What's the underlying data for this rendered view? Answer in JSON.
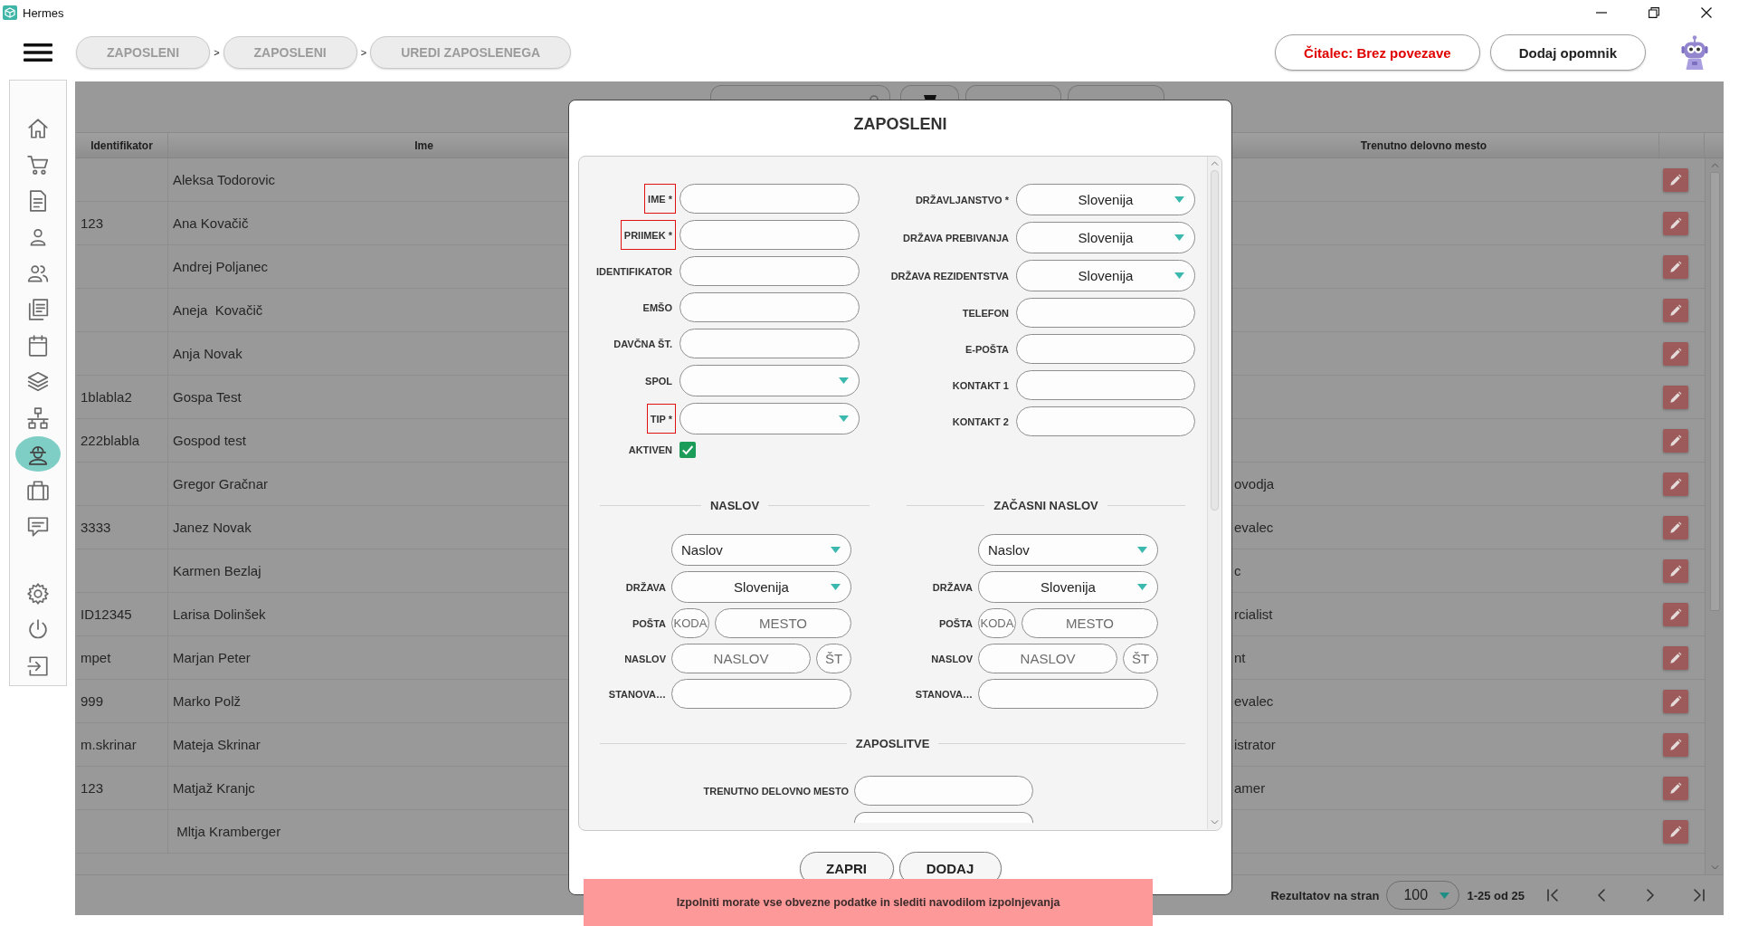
{
  "window": {
    "title": "Hermes"
  },
  "top_bar": {
    "breadcrumbs": [
      {
        "label": "ZAPOSLENI"
      },
      {
        "separator": ">",
        "label": "ZAPOSLENI"
      },
      {
        "separator": ">",
        "label": "UREDI ZAPOSLENEGA"
      }
    ],
    "buttons": [
      {
        "label": "Čitalec: Brez povezave",
        "kind": "alert"
      },
      {
        "label": "Dodaj opomnik",
        "kind": "plain"
      }
    ]
  },
  "sidebar": {
    "items": [
      {
        "selected": false
      },
      {
        "selected": false
      },
      {
        "selected": false
      },
      {
        "selected": false
      },
      {
        "selected": false
      },
      {
        "selected": false
      },
      {
        "selected": false
      },
      {
        "selected": false
      },
      {
        "selected": false
      },
      {
        "selected": true
      },
      {
        "selected": false
      },
      {
        "selected": false
      }
    ],
    "bottom_items": [
      {
        "selected": false
      },
      {
        "selected": false
      },
      {
        "selected": false
      }
    ]
  },
  "table": {
    "columns": [
      {
        "label": "Identifikator"
      },
      {
        "label": "Ime"
      },
      {
        "label": "Trenutno delovno mesto"
      }
    ],
    "rows": [
      {
        "ime": "Aleksa Todorovic"
      },
      {
        "identifikator": "123",
        "ime": "Ana Kovačič"
      },
      {
        "ime": "Andrej Poljanec"
      },
      {
        "ime": "Aneja  Kovačič"
      },
      {
        "ime": "Anja Novak"
      },
      {
        "identifikator": "1blabla2",
        "ime": "Gospa Test"
      },
      {
        "identifikator": "222blabla",
        "ime": "Gospod test"
      },
      {
        "ime": "Gregor Gračnar",
        "trenutno_delovno_mesto": "ovodja"
      },
      {
        "identifikator": "3333",
        "ime": "Janez Novak",
        "trenutno_delovno_mesto": "evalec"
      },
      {
        "ime": "Karmen Bezlaj",
        "trenutno_delovno_mesto": "c"
      },
      {
        "identifikator": "ID12345",
        "ime": "Larisa Dolinšek",
        "trenutno_delovno_mesto": "rcialist"
      },
      {
        "identifikator": "mpet",
        "ime": "Marjan Peter",
        "trenutno_delovno_mesto": "nt"
      },
      {
        "identifikator": "999",
        "ime": "Marko Polž",
        "trenutno_delovno_mesto": "evalec"
      },
      {
        "identifikator": "m.skrinar",
        "ime": "Mateja Skrinar",
        "trenutno_delovno_mesto": "istrator"
      },
      {
        "identifikator": "123",
        "ime": "Matjaž Kranjc",
        "trenutno_delovno_mesto": "amer"
      },
      {
        "ime": " Mltja Kramberger"
      }
    ]
  },
  "pagination": {
    "label": "Rezultatov na stran",
    "page_size": "100",
    "range": "1-25 od 25"
  },
  "modal": {
    "title": "ZAPOSLENI",
    "left_fields": [
      {
        "label": "IME *",
        "kind": "text",
        "error": true
      },
      {
        "label": "PRIIMEK *",
        "kind": "text",
        "error": true
      },
      {
        "label": "IDENTIFIKATOR",
        "kind": "text",
        "error": false
      },
      {
        "label": "EMŠO",
        "kind": "text",
        "error": false
      },
      {
        "label": "DAVČNA ŠT.",
        "kind": "text",
        "error": false
      },
      {
        "label": "SPOL",
        "kind": "select",
        "error": false
      },
      {
        "label": "TIP *",
        "kind": "select",
        "error": true
      }
    ],
    "active": {
      "label": "AKTIVEN",
      "checked": true
    },
    "right_fields": [
      {
        "label": "DRŽAVLJANSTVO *",
        "kind": "select",
        "value": "Slovenija",
        "error": false
      },
      {
        "label": "DRŽAVA PREBIVANJA",
        "kind": "select",
        "value": "Slovenija",
        "error": false
      },
      {
        "label": "DRŽAVA REZIDENTSTVA",
        "kind": "select",
        "value": "Slovenija",
        "error": false
      },
      {
        "label": "TELEFON",
        "kind": "text",
        "error": false
      },
      {
        "label": "E-POŠTA",
        "kind": "text",
        "error": false
      },
      {
        "label": "KONTAKT 1",
        "kind": "text",
        "error": false
      },
      {
        "label": "KONTAKT 2",
        "kind": "text",
        "error": false
      }
    ],
    "addresses": [
      {
        "title": "NASLOV",
        "type": "Naslov",
        "country_label": "DRŽAVA",
        "country": "Slovenija",
        "post_label": "POŠTA",
        "post_code_placeholder": "KODA",
        "city_placeholder": "MESTO",
        "street_label": "NASLOV",
        "street_placeholder": "NASLOV",
        "number_placeholder": "ŠT",
        "apartment_label": "STANOVA…"
      },
      {
        "title": "ZAČASNI NASLOV",
        "type": "Naslov",
        "country_label": "DRŽAVA",
        "country": "Slovenija",
        "post_label": "POŠTA",
        "post_code_placeholder": "KODA",
        "city_placeholder": "MESTO",
        "street_label": "NASLOV",
        "street_placeholder": "NASLOV",
        "number_placeholder": "ŠT",
        "apartment_label": "STANOVA…"
      }
    ],
    "employment": {
      "title": "ZAPOSLITVE",
      "fields": [
        {
          "label": "TRENUTNO DELOVNO MESTO",
          "kind": "text"
        },
        {
          "kind": "text"
        }
      ]
    },
    "buttons": [
      {
        "label": "ZAPRI"
      },
      {
        "label": "DODAJ"
      }
    ]
  },
  "toast": {
    "message": "Izpolniti morate vse obvezne podatke in slediti navodilom izpolnjevanja"
  }
}
